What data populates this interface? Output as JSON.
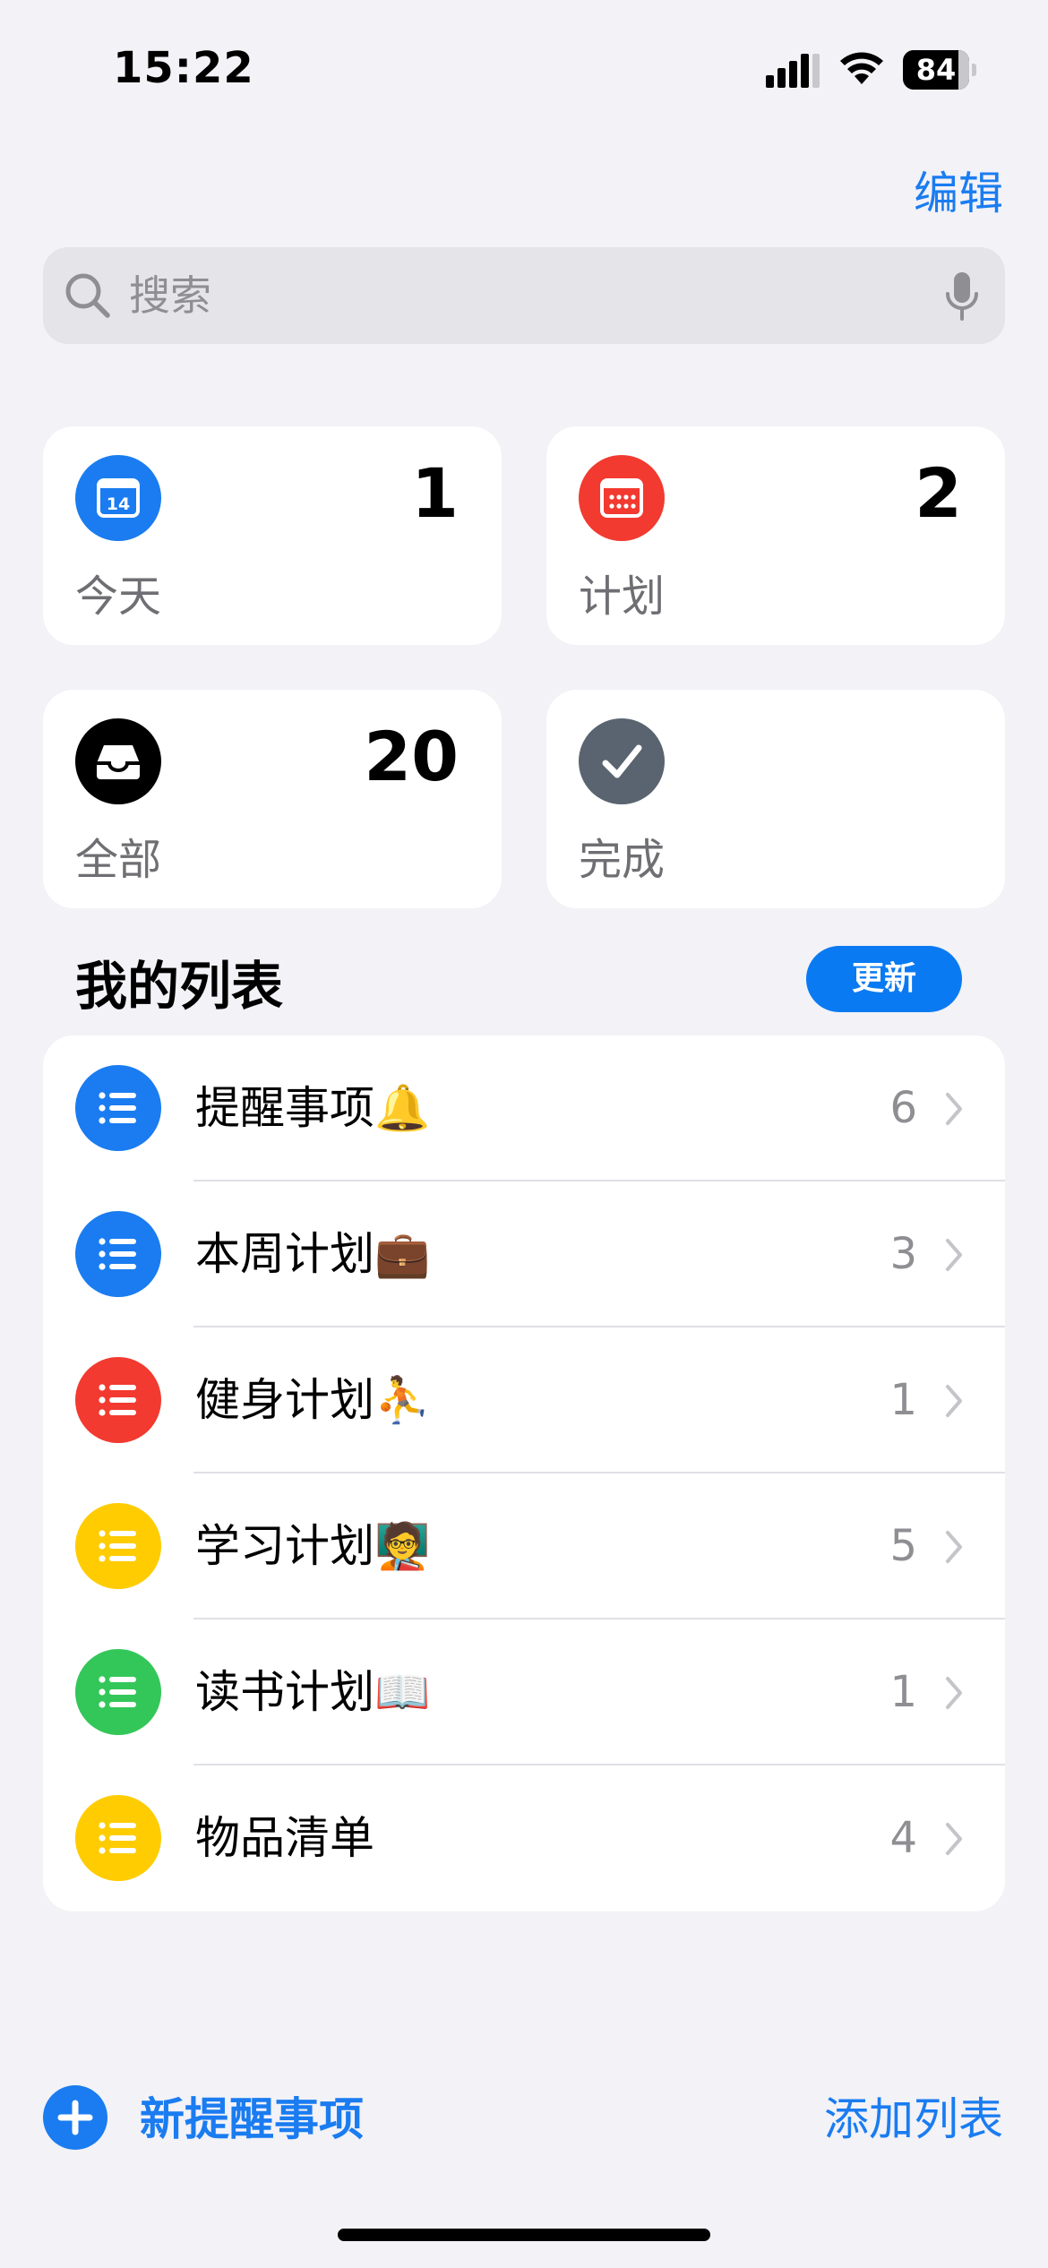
{
  "status_bar": {
    "time": "15:22",
    "battery": "84",
    "icons": [
      "signal-icon",
      "wifi-icon",
      "battery-icon"
    ]
  },
  "header": {
    "edit_label": "编辑"
  },
  "search": {
    "placeholder": "搜索",
    "icons": [
      "search-icon",
      "microphone-icon"
    ]
  },
  "smart_lists": [
    {
      "label": "今天",
      "count": "1",
      "color": "#1a7cf0",
      "icon": "calendar-today-icon",
      "day": "14"
    },
    {
      "label": "计划",
      "count": "2",
      "color": "#f23a30",
      "icon": "calendar-grid-icon"
    },
    {
      "label": "全部",
      "count": "20",
      "color": "#000000",
      "icon": "tray-icon"
    },
    {
      "label": "完成",
      "count": "",
      "color": "#5a6470",
      "icon": "checkmark-icon"
    }
  ],
  "my_lists": {
    "title": "我的列表",
    "update_label": "更新",
    "items": [
      {
        "label": "提醒事项🔔",
        "count": "6",
        "color": "#1a7cf0",
        "icon": "list-bullet-icon"
      },
      {
        "label": "本周计划💼",
        "count": "3",
        "color": "#1a7cf0",
        "icon": "list-bullet-icon"
      },
      {
        "label": "健身计划⛹",
        "count": "1",
        "color": "#f23a30",
        "icon": "list-bullet-icon"
      },
      {
        "label": "学习计划🧑‍🏫",
        "count": "5",
        "color": "#fecc00",
        "icon": "list-bullet-icon"
      },
      {
        "label": "读书计划📖",
        "count": "1",
        "color": "#33c759",
        "icon": "list-bullet-icon"
      },
      {
        "label": "物品清单",
        "count": "4",
        "color": "#fecc00",
        "icon": "list-bullet-icon"
      }
    ]
  },
  "bottom_bar": {
    "new_reminder_label": "新提醒事项",
    "add_list_label": "添加列表"
  },
  "colors": {
    "accent": "#1a7cf0",
    "background": "#f2f2f7"
  }
}
